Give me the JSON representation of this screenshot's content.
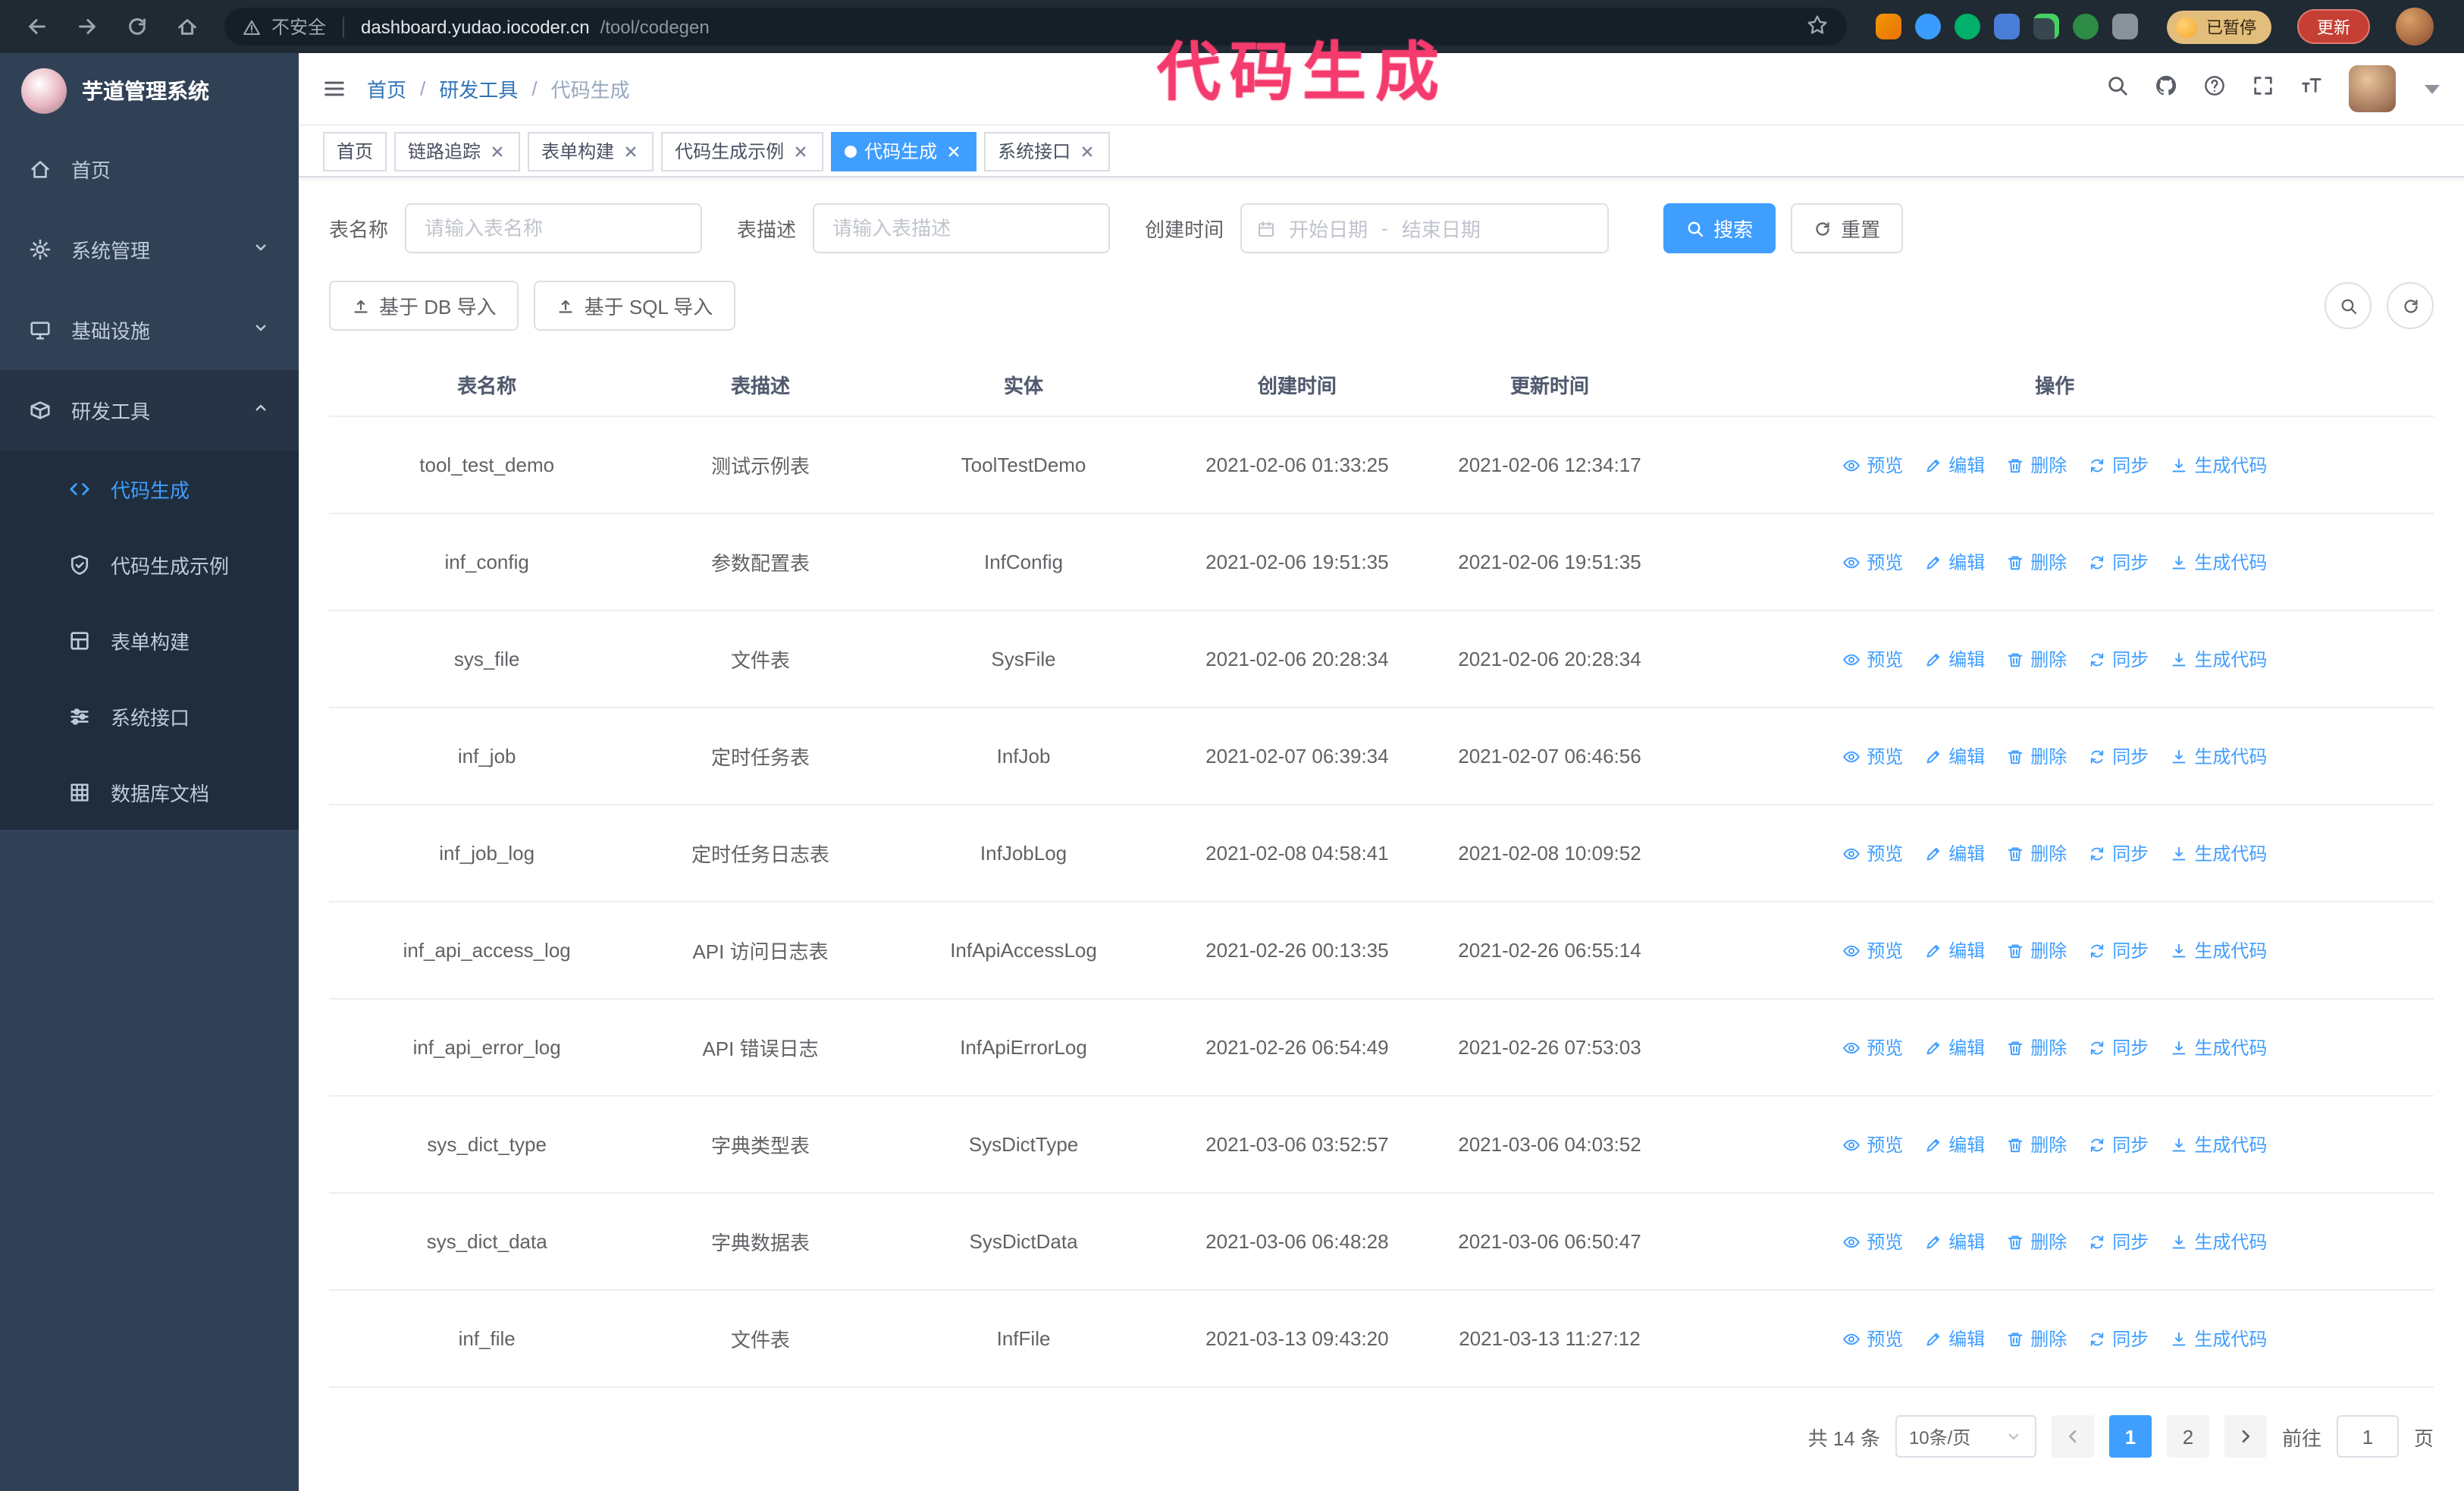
{
  "annotation": {
    "text": "代码生成",
    "color": "#f53b6e"
  },
  "browser": {
    "security_label": "不安全",
    "url_host": "dashboard.yudao.iocoder.cn",
    "url_path": "/tool/codegen",
    "paused_badge": "已暂停",
    "update_button": "更新"
  },
  "sidebar": {
    "logo_title": "芋道管理系统",
    "items": [
      {
        "label": "首页"
      },
      {
        "label": "系统管理"
      },
      {
        "label": "基础设施"
      },
      {
        "label": "研发工具"
      }
    ],
    "submenu": [
      {
        "label": "代码生成"
      },
      {
        "label": "代码生成示例"
      },
      {
        "label": "表单构建"
      },
      {
        "label": "系统接口"
      },
      {
        "label": "数据库文档"
      }
    ]
  },
  "breadcrumb": {
    "items": [
      "首页",
      "研发工具",
      "代码生成"
    ],
    "separator": "/"
  },
  "tabs": [
    {
      "label": "首页"
    },
    {
      "label": "链路追踪"
    },
    {
      "label": "表单构建"
    },
    {
      "label": "代码生成示例"
    },
    {
      "label": "代码生成"
    },
    {
      "label": "系统接口"
    }
  ],
  "filters": {
    "table_name_label": "表名称",
    "table_name_placeholder": "请输入表名称",
    "table_desc_label": "表描述",
    "table_desc_placeholder": "请输入表描述",
    "create_time_label": "创建时间",
    "date_start_placeholder": "开始日期",
    "date_separator": "-",
    "date_end_placeholder": "结束日期",
    "search_button": "搜索",
    "reset_button": "重置"
  },
  "toolbar": {
    "import_db_button": "基于 DB 导入",
    "import_sql_button": "基于 SQL 导入"
  },
  "table": {
    "columns": [
      "表名称",
      "表描述",
      "实体",
      "创建时间",
      "更新时间",
      "操作"
    ],
    "actions": [
      "预览",
      "编辑",
      "删除",
      "同步",
      "生成代码"
    ],
    "rows": [
      {
        "name": "tool_test_demo",
        "desc": "测试示例表",
        "entity": "ToolTestDemo",
        "created": "2021-02-06 01:33:25",
        "updated": "2021-02-06 12:34:17"
      },
      {
        "name": "inf_config",
        "desc": "参数配置表",
        "entity": "InfConfig",
        "created": "2021-02-06 19:51:35",
        "updated": "2021-02-06 19:51:35"
      },
      {
        "name": "sys_file",
        "desc": "文件表",
        "entity": "SysFile",
        "created": "2021-02-06 20:28:34",
        "updated": "2021-02-06 20:28:34"
      },
      {
        "name": "inf_job",
        "desc": "定时任务表",
        "entity": "InfJob",
        "created": "2021-02-07 06:39:34",
        "updated": "2021-02-07 06:46:56"
      },
      {
        "name": "inf_job_log",
        "desc": "定时任务日志表",
        "entity": "InfJobLog",
        "created": "2021-02-08 04:58:41",
        "updated": "2021-02-08 10:09:52"
      },
      {
        "name": "inf_api_access_log",
        "desc": "API 访问日志表",
        "entity": "InfApiAccessLog",
        "created": "2021-02-26 00:13:35",
        "updated": "2021-02-26 06:55:14"
      },
      {
        "name": "inf_api_error_log",
        "desc": "API 错误日志",
        "entity": "InfApiErrorLog",
        "created": "2021-02-26 06:54:49",
        "updated": "2021-02-26 07:53:03"
      },
      {
        "name": "sys_dict_type",
        "desc": "字典类型表",
        "entity": "SysDictType",
        "created": "2021-03-06 03:52:57",
        "updated": "2021-03-06 04:03:52"
      },
      {
        "name": "sys_dict_data",
        "desc": "字典数据表",
        "entity": "SysDictData",
        "created": "2021-03-06 06:48:28",
        "updated": "2021-03-06 06:50:47"
      },
      {
        "name": "inf_file",
        "desc": "文件表",
        "entity": "InfFile",
        "created": "2021-03-13 09:43:20",
        "updated": "2021-03-13 11:27:12"
      }
    ]
  },
  "pagination": {
    "total_label": "共 14 条",
    "page_size_label": "10条/页",
    "pages": [
      "1",
      "2"
    ],
    "goto_label": "前往",
    "goto_value": "1",
    "goto_unit_label": "页"
  },
  "colors": {
    "primary": "#409eff",
    "sidebar_bg": "#304156",
    "submenu_bg": "#1f2d3d",
    "annotation": "#f53b6e"
  }
}
